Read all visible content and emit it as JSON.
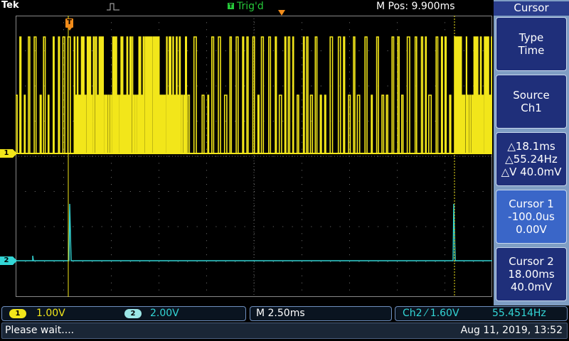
{
  "topbar": {
    "brand": "Tek",
    "acq_icon": "pulse-acquire-icon",
    "trigger_status": "Trig'd",
    "trigger_icon_letter": "T",
    "mpos": "M Pos: 9.900ms"
  },
  "markers": {
    "ch1": "1",
    "ch2": "2",
    "trigger_letter": "T"
  },
  "menu": {
    "title": "Cursor",
    "type": {
      "line1": "Type",
      "line2": "Time"
    },
    "source": {
      "line1": "Source",
      "line2": "Ch1"
    },
    "readout": {
      "line1": "△18.1ms",
      "line2": "△55.24Hz",
      "line3": "△V 40.0mV"
    },
    "cursor1": {
      "line1": "Cursor 1",
      "line2": "-100.0us",
      "line3": "0.00V"
    },
    "cursor2": {
      "line1": "Cursor 2",
      "line2": "18.00ms",
      "line3": "40.0mV"
    }
  },
  "status": {
    "ch1_badge": "1",
    "ch1_scale": "1.00V",
    "ch2_badge": "2",
    "ch2_scale": "2.00V",
    "timebase": "M 2.50ms",
    "trigger": "Ch2 ⁄ 1.60V",
    "frequency": "55.4514Hz",
    "message": "Please wait....",
    "datetime": "Aug 11, 2019, 13:52"
  },
  "colors": {
    "ch1": "#f2e61a",
    "ch2": "#33d6d6",
    "trigger": "#f28c1a",
    "menu_bg": "#1f2f7a"
  }
}
